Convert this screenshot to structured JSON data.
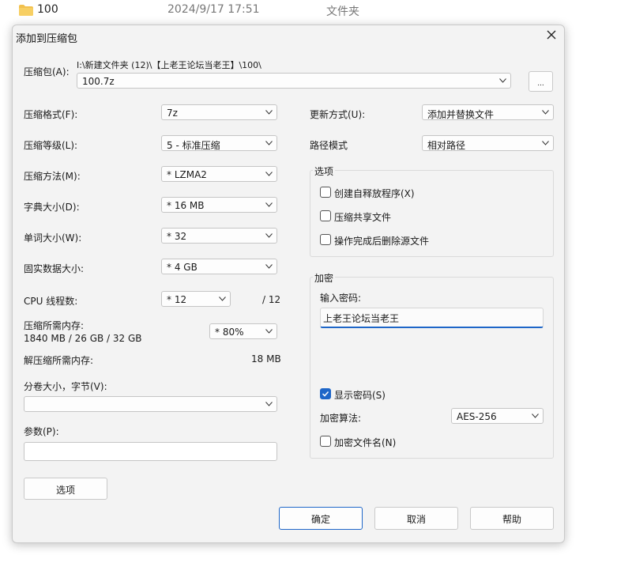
{
  "background_row": {
    "name": "100",
    "date": "2024/9/17 17:51",
    "type": "文件夹"
  },
  "dialog": {
    "title": "添加到压缩包",
    "archive": {
      "label": "压缩包(A):",
      "path": "I:\\新建文件夹 (12)\\【上老王论坛当老王】\\100\\",
      "value": "100.7z",
      "browse": "..."
    },
    "left": {
      "format": {
        "label": "压缩格式(F):",
        "value": "7z"
      },
      "level": {
        "label": "压缩等级(L):",
        "value": "5 - 标准压缩"
      },
      "method": {
        "label": "压缩方法(M):",
        "value": "* LZMA2"
      },
      "dict": {
        "label": "字典大小(D):",
        "value": "* 16 MB"
      },
      "word": {
        "label": "单词大小(W):",
        "value": "* 32"
      },
      "solid": {
        "label": "固实数据大小:",
        "value": "* 4 GB"
      },
      "cpu": {
        "label": "CPU 线程数:",
        "value": "* 12",
        "total": "/ 12"
      },
      "mem": {
        "label": "压缩所需内存:",
        "detail": "1840 MB / 26 GB / 32 GB",
        "value": "* 80%"
      },
      "decomp": {
        "label": "解压缩所需内存:",
        "value": "18 MB"
      },
      "volume": {
        "label": "分卷大小，字节(V):",
        "value": ""
      },
      "params": {
        "label": "参数(P):",
        "value": ""
      },
      "options_button": "选项"
    },
    "right": {
      "update": {
        "label": "更新方式(U):",
        "value": "添加并替换文件"
      },
      "path_mode": {
        "label": "路径模式",
        "value": "相对路径"
      },
      "options": {
        "title": "选项",
        "sfx": "创建自释放程序(X)",
        "shared": "压缩共享文件",
        "delete": "操作完成后删除源文件"
      },
      "encryption": {
        "title": "加密",
        "password_label": "输入密码:",
        "password_value": "上老王论坛当老王",
        "show_password": "显示密码(S)",
        "show_password_checked": true,
        "method_label": "加密算法:",
        "method_value": "AES-256",
        "encrypt_names": "加密文件名(N)"
      }
    },
    "buttons": {
      "ok": "确定",
      "cancel": "取消",
      "help": "帮助"
    }
  },
  "colors": {
    "accent": "#1e66c8",
    "folder": "#f2c14e"
  }
}
